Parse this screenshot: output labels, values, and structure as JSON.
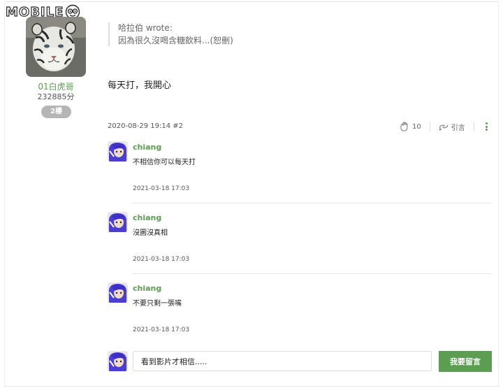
{
  "header": {
    "logo_text": "MOBILE"
  },
  "author": {
    "name": "01白虎哥",
    "score": "232885分",
    "floor_badge": "2樓"
  },
  "post": {
    "quote_author": "哈拉伯 wrote:",
    "quote_text": "因為很久沒喝含糖飲料...(恕刪)",
    "body": "每天打，我開心",
    "meta": "2020-08-29 19:14 #2",
    "like_count": "10",
    "quote_label": "引言"
  },
  "comments": [
    {
      "name": "chiang",
      "text": "不相信你可以每天打",
      "time": "2021-03-18 17:03"
    },
    {
      "name": "chiang",
      "text": "沒圖沒真相",
      "time": "2021-03-18 17:03"
    },
    {
      "name": "chiang",
      "text": "不要只剩一張嘴",
      "time": "2021-03-18 17:03"
    }
  ],
  "reply": {
    "input_value": "看到影片才相信.....",
    "button_label": "我要留言"
  },
  "colors": {
    "accent": "#5b9e51",
    "badge": "#b5b5b5"
  }
}
